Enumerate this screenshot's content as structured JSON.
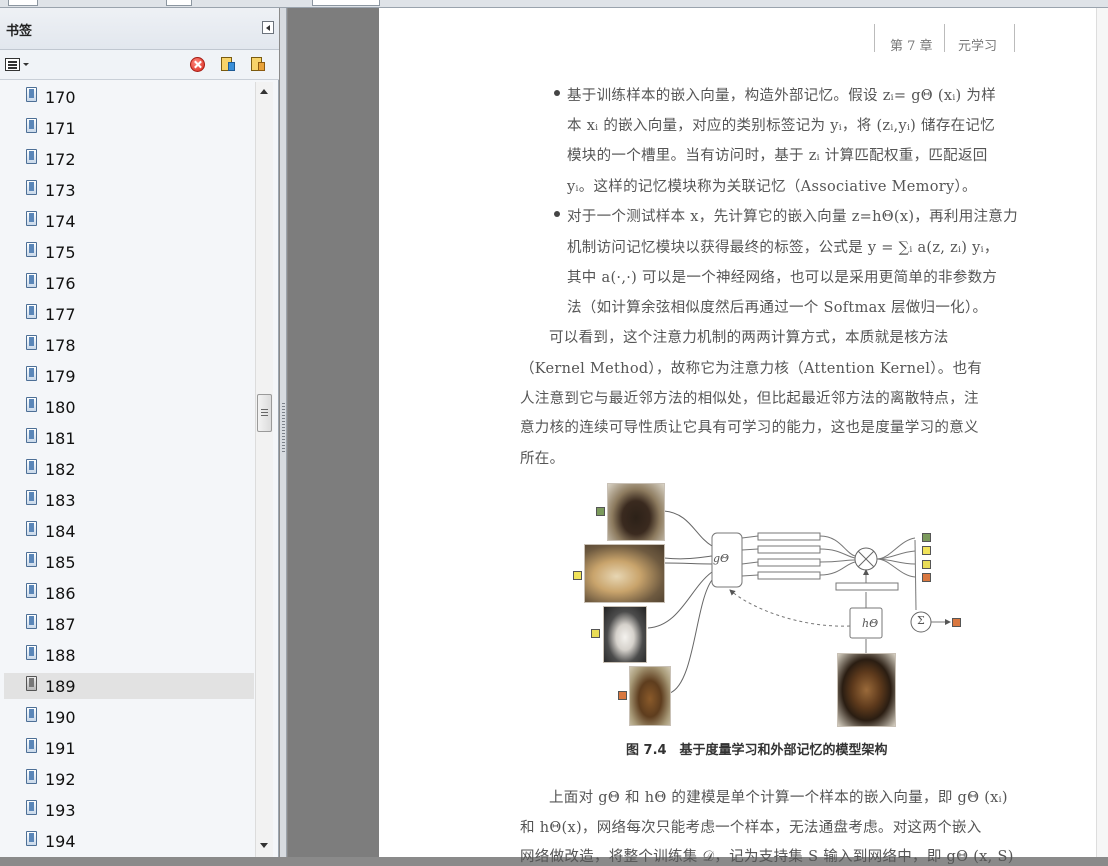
{
  "sidebar": {
    "title": "书签",
    "bookmarks": [
      "170",
      "171",
      "172",
      "173",
      "174",
      "175",
      "176",
      "177",
      "178",
      "179",
      "180",
      "181",
      "182",
      "183",
      "184",
      "185",
      "186",
      "187",
      "188",
      "189",
      "190",
      "191",
      "192",
      "193",
      "194"
    ],
    "selected": "189"
  },
  "page": {
    "running_head": {
      "chapter": "第 7 章",
      "title": "元学习"
    },
    "lines": [
      "基于训练样本的嵌入向量，构造外部记忆。假设 zᵢ= gΘ (xᵢ) 为样",
      "本 xᵢ 的嵌入向量，对应的类别标签记为 yᵢ，将 (zᵢ,yᵢ) 储存在记忆",
      "模块的一个槽里。当有访问时，基于 zᵢ 计算匹配权重，匹配返回",
      "yᵢ。这样的记忆模块称为关联记忆（Associative Memory）。",
      "对于一个测试样本 x，先计算它的嵌入向量 z=hΘ(x)，再利用注意力",
      "机制访问记忆模块以获得最终的标签，公式是 y = ∑ᵢ a(z, zᵢ) yᵢ，",
      "其中 a(·,·) 可以是一个神经网络，也可以是采用更简单的非参数方",
      "法（如计算余弦相似度然后再通过一个 Softmax 层做归一化）。",
      "可以看到，这个注意力机制的两两计算方式，本质就是核方法",
      "（Kernel Method），故称它为注意力核（Attention Kernel）。也有",
      "人注意到它与最近邻方法的相似处，但比起最近邻方法的离散特点，注",
      "意力核的连续可导性质让它具有可学习的能力，这也是度量学习的意义",
      "所在。",
      "上面对 gΘ 和 hΘ 的建模是单个计算一个样本的嵌入向量，即 gΘ (xᵢ)",
      "和 hΘ(x)，网络每次只能考虑一个样本，无法通盘考虑。对这两个嵌入",
      "网络做改造，将整个训练集 𝒟，记为支持集 S 输入到网络中，即 gΘ (x, S)"
    ],
    "figure": {
      "caption": "图 7.4　基于度量学习和外部记忆的模型架构",
      "g_label": "gΘ",
      "h_label": "hΘ",
      "marker_colors": [
        "#7b9a5c",
        "#f1e35a",
        "#e9dc56",
        "#d9773f"
      ]
    }
  }
}
